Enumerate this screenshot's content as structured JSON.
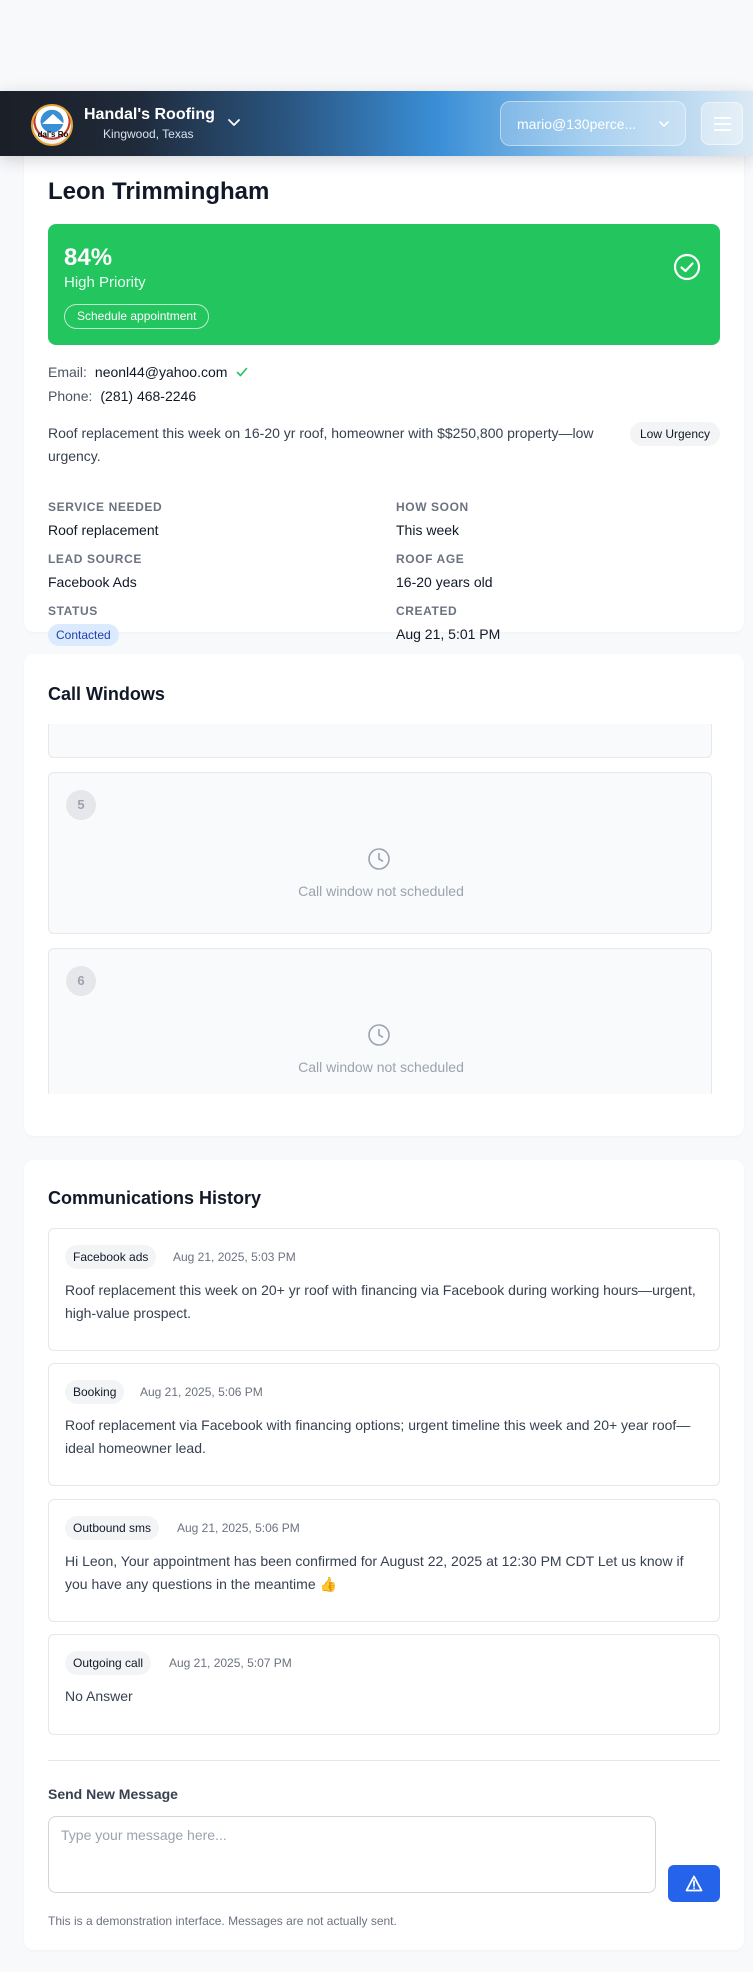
{
  "header": {
    "company_name": "Handal's Roofing",
    "company_location": "Kingwood, Texas",
    "logo_text": "dal's Ro",
    "account_email": "mario@130perce...",
    "icons": [
      "company-logo",
      "chevron-down-icon",
      "menu-icon"
    ]
  },
  "lead": {
    "name": "Leon Trimmingham",
    "score": "84%",
    "priority": "High Priority",
    "schedule_label": "Schedule appointment",
    "email_label": "Email:",
    "email": "neonl44@yahoo.com",
    "phone_label": "Phone:",
    "phone": "(281) 468-2246",
    "summary": "Roof replacement this week on 16-20 yr roof, homeowner with $$250,800 property—low urgency.",
    "urgency": "Low Urgency",
    "fields": {
      "service_needed_label": "SERVICE NEEDED",
      "service_needed": "Roof replacement",
      "how_soon_label": "HOW SOON",
      "how_soon": "This week",
      "lead_source_label": "LEAD SOURCE",
      "lead_source": "Facebook Ads",
      "roof_age_label": "ROOF AGE",
      "roof_age": "16-20 years old",
      "status_label": "STATUS",
      "status": "Contacted",
      "created_label": "CREATED",
      "created": "Aug 21, 5:01 PM"
    }
  },
  "call_windows": {
    "title": "Call Windows",
    "items": [
      {
        "number": "5",
        "message": "Call window not scheduled"
      },
      {
        "number": "6",
        "message": "Call window not scheduled"
      }
    ]
  },
  "communications": {
    "title": "Communications History",
    "items": [
      {
        "type": "Facebook ads",
        "time": "Aug 21, 2025, 5:03 PM",
        "text": "Roof replacement this week on 20+ yr roof with financing via Facebook during working hours—urgent, high-value prospect."
      },
      {
        "type": "Booking",
        "time": "Aug 21, 2025, 5:06 PM",
        "text": "Roof replacement via Facebook with financing options; urgent timeline this week and 20+ year roof—ideal homeowner lead."
      },
      {
        "type": "Outbound sms",
        "time": "Aug 21, 2025, 5:06 PM",
        "text": "Hi Leon, Your appointment has been confirmed for August 22, 2025 at 12:30 PM CDT Let us know if you have any questions in the meantime 👍"
      },
      {
        "type": "Outgoing call",
        "time": "Aug 21, 2025, 5:07 PM",
        "text": "No Answer"
      }
    ],
    "send_label": "Send New Message",
    "input_placeholder": "Type your message here...",
    "disclaimer": "This is a demonstration interface. Messages are not actually sent."
  },
  "colors": {
    "priority_green": "#22c55e",
    "send_blue": "#2563eb",
    "status_bg": "#dbeafe",
    "status_text": "#1e40af"
  }
}
